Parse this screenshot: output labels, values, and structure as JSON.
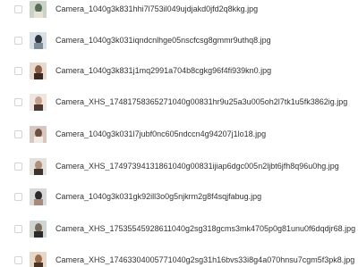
{
  "files": [
    {
      "name": "Camera_1040g3k831hhi7l753il049ujdjakd0jfd2q8kkg.jpg",
      "icon": "image-thumbnail-icon",
      "colors": [
        "#c9d4c7",
        "#5b6b57",
        "#e8e2d6"
      ]
    },
    {
      "name": "Camera_1040g3k031iqndcnlhge05nscfcsg8gmmr9uthq8.jpg",
      "icon": "image-thumbnail-icon",
      "colors": [
        "#d8dfe6",
        "#2f3640",
        "#7f8b97"
      ]
    },
    {
      "name": "Camera_1040g3k831j1mq2991a704b8cgkg96f4fi939kn0.jpg",
      "icon": "image-thumbnail-icon",
      "colors": [
        "#e9d9cc",
        "#8a5a44",
        "#3b2a22"
      ]
    },
    {
      "name": "Camera_XHS_17481758365271040g00831hr9u25a3u005oh2l7tk1u5fk3862ig.jpg",
      "icon": "image-thumbnail-icon",
      "colors": [
        "#efe6df",
        "#c7a38f",
        "#4a3a33"
      ]
    },
    {
      "name": "Camera_1040g3k031l7jubf0nc605ndccn4g94207j1lo18.jpg",
      "icon": "image-thumbnail-icon",
      "colors": [
        "#d9c7bd",
        "#6e4f43",
        "#f1ebe6"
      ]
    },
    {
      "name": "Camera_XHS_17497394131861040g00831ijiap6dgc005n2ljbt6jfh8q96u0hg.jpg",
      "icon": "image-thumbnail-icon",
      "colors": [
        "#e4e0dc",
        "#b08e7c",
        "#3d3330"
      ]
    },
    {
      "name": "Camera_1040g3k031gk92ill3o0g5njkrm2g8f4sqjfabug.jpg",
      "icon": "image-thumbnail-icon",
      "colors": [
        "#d6d8da",
        "#2e2a2a",
        "#a88a7a"
      ]
    },
    {
      "name": "Camera_XHS_17535545928611040g2sg318gcms3mk4705p0g81unu0f6dqdjr68.jpg",
      "icon": "image-thumbnail-icon",
      "colors": [
        "#cfd6cf",
        "#7a6a60",
        "#2b2b2b"
      ]
    },
    {
      "name": "Camera_XHS_17463304005771040g2sg31h16bvs33i8g4a070hnsu7cgm5f3pk8.jpg",
      "icon": "image-thumbnail-icon",
      "colors": [
        "#e7d7c6",
        "#9c6b4e",
        "#4a3225"
      ]
    }
  ],
  "colors": {
    "checkbox_border": "#d3d3d3",
    "text": "#333333",
    "background": "#ffffff"
  }
}
